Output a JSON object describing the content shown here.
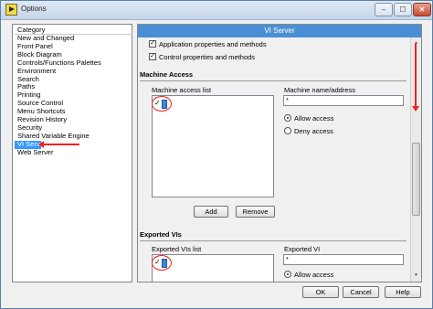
{
  "window": {
    "title": "Options",
    "minimize": "–",
    "maximize": "☐",
    "close": "✕"
  },
  "sidebar": {
    "header": "Category",
    "items": [
      {
        "label": "New and Changed"
      },
      {
        "label": "Front Panel"
      },
      {
        "label": "Block Diagram"
      },
      {
        "label": "Controls/Functions Palettes"
      },
      {
        "label": "Environment"
      },
      {
        "label": "Search"
      },
      {
        "label": "Paths"
      },
      {
        "label": "Printing"
      },
      {
        "label": "Source Control"
      },
      {
        "label": "Menu Shortcuts"
      },
      {
        "label": "Revision History"
      },
      {
        "label": "Security"
      },
      {
        "label": "Shared Variable Engine"
      },
      {
        "label": "VI Server"
      },
      {
        "label": "Web Server"
      }
    ],
    "selected_label": "VI Server"
  },
  "panel": {
    "header": "VI Server",
    "app_props_label": "Application properties and methods",
    "control_props_label": "Control properties and methods",
    "machine_access": {
      "title": "Machine Access",
      "list_label": "Machine access list",
      "name_label": "Machine name/address",
      "name_value": "*",
      "allow_label": "Allow access",
      "deny_label": "Deny access",
      "add_label": "Add",
      "remove_label": "Remove"
    },
    "exported_vis": {
      "title": "Exported VIs",
      "list_label": "Exported VIs list",
      "vi_label": "Exported VI",
      "vi_value": "*",
      "allow_label": "Allow access"
    }
  },
  "footer": {
    "ok_label": "OK",
    "cancel_label": "Cancel",
    "help_label": "Help"
  }
}
